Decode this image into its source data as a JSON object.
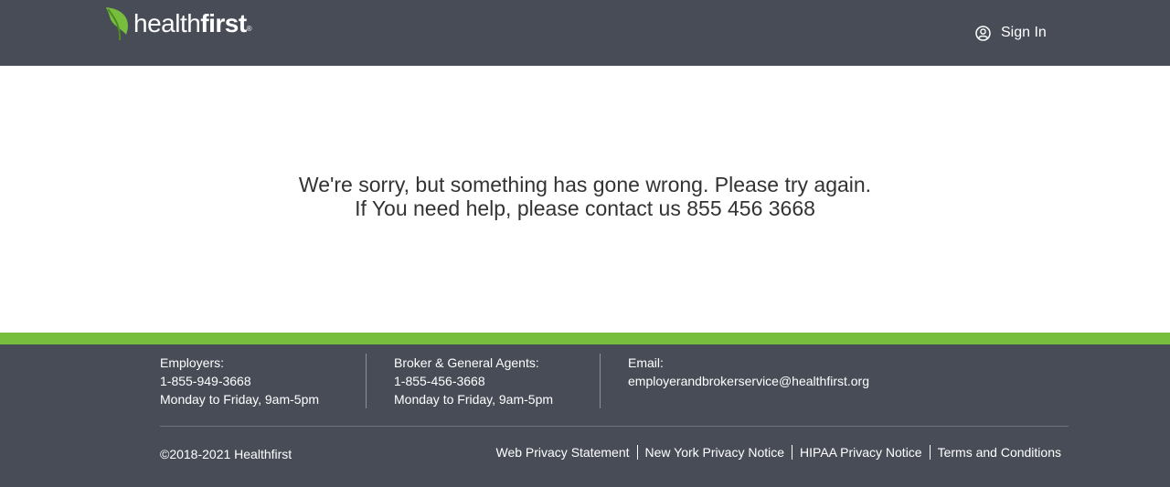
{
  "header": {
    "logo_text_light": "health",
    "logo_text_bold": "first",
    "logo_reg": "®",
    "signin_label": "Sign In"
  },
  "main": {
    "error_line_1": "We're sorry, but something has gone wrong. Please try again.",
    "error_line_2": "If You need help, please contact us 855 456 3668"
  },
  "footer": {
    "contacts": [
      {
        "label": "Employers:",
        "value": "1-855-949-3668",
        "hours": "Monday to Friday, 9am-5pm"
      },
      {
        "label": "Broker & General Agents:",
        "value": "1-855-456-3668",
        "hours": "Monday to Friday, 9am-5pm"
      },
      {
        "label": "Email:",
        "value": "employerandbrokerservice@healthfirst.org"
      }
    ],
    "copyright": "©2018-2021 Healthfirst",
    "links": [
      "Web Privacy Statement",
      "New York Privacy Notice",
      "HIPAA Privacy Notice",
      "Terms and Conditions"
    ]
  },
  "colors": {
    "header_bg": "#474c57",
    "accent_green": "#78be3e",
    "text_dark": "#333333"
  },
  "icons": {
    "logo_leaf": "leaf-icon",
    "signin": "user-circle-icon"
  }
}
